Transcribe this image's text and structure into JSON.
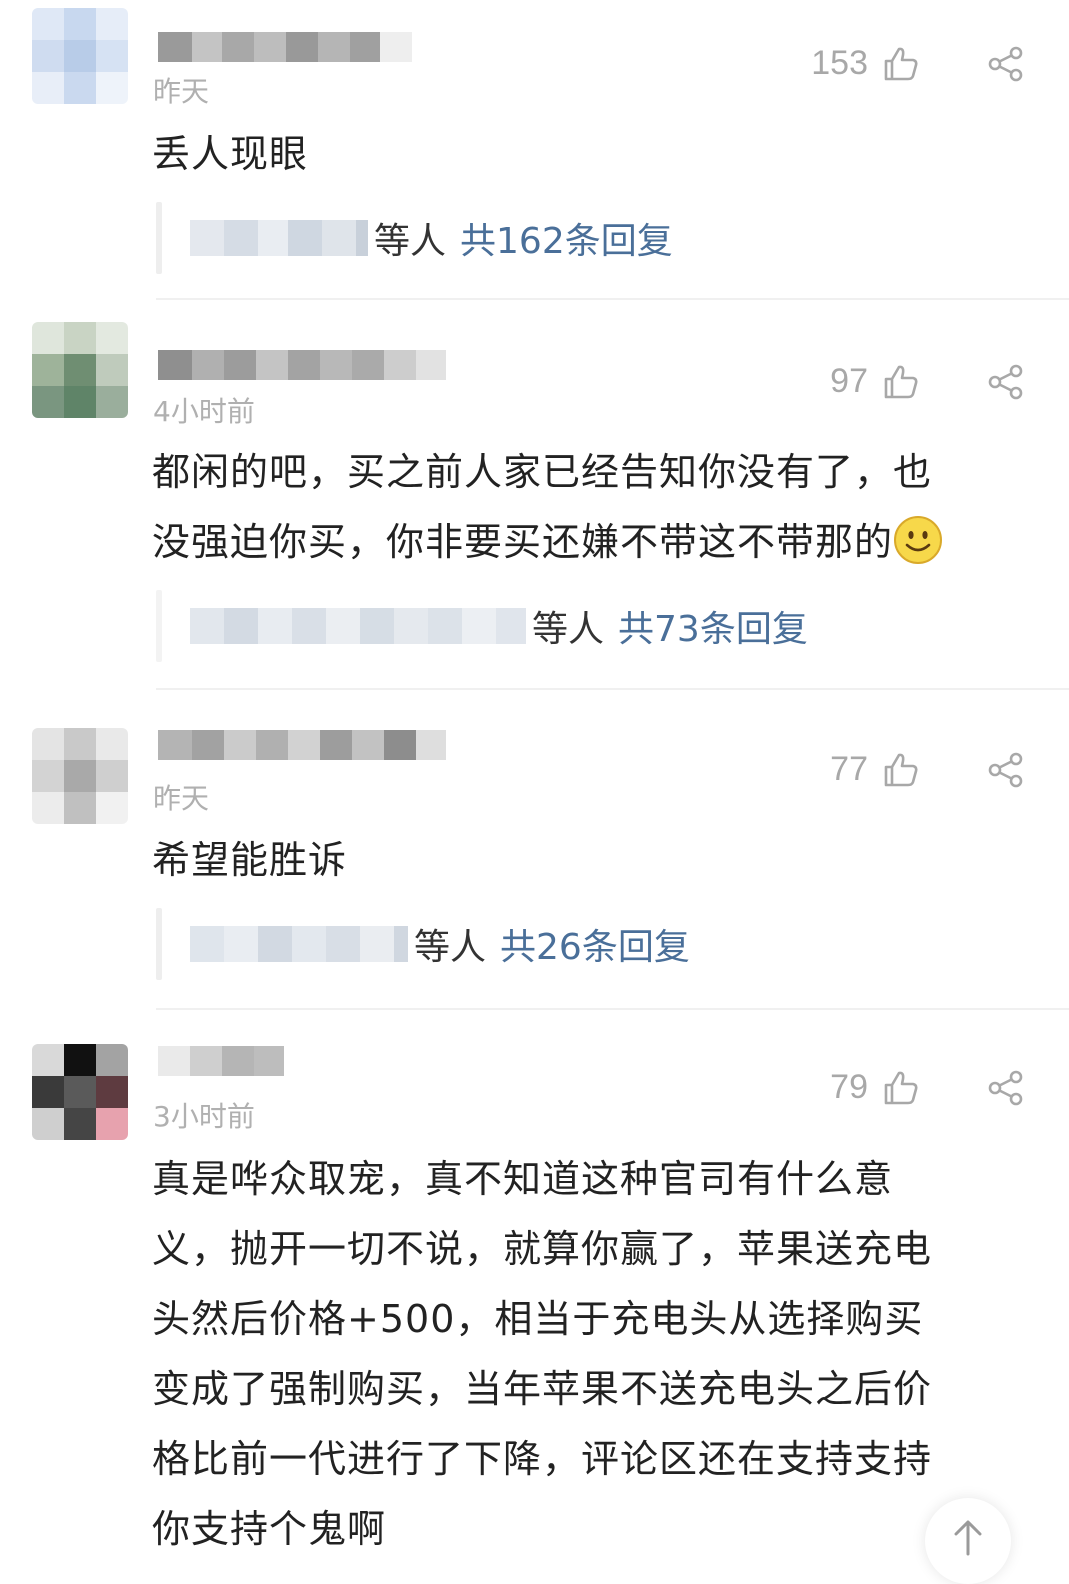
{
  "comments": [
    {
      "time": "昨天",
      "likes": "153",
      "text": [
        "丢人现眼"
      ],
      "reply_suffix": "等人",
      "reply_count": "共162条回复"
    },
    {
      "time": "4小时前",
      "likes": "97",
      "text": [
        "都闲的吧，买之前人家已经告知你没有了，也",
        "没强迫你买，你非要买还嫌不带这不带那的"
      ],
      "emoji": "smile-emoji",
      "reply_suffix": "等人",
      "reply_count": "共73条回复"
    },
    {
      "time": "昨天",
      "likes": "77",
      "text": [
        "希望能胜诉"
      ],
      "reply_suffix": "等人",
      "reply_count": "共26条回复"
    },
    {
      "time": "3小时前",
      "likes": "79",
      "text": [
        "真是哗众取宠，真不知道这种官司有什么意",
        "义，抛开一切不说，就算你赢了，苹果送充电",
        "头然后价格+500，相当于充电头从选择购买",
        "变成了强制购买，当年苹果不送充电头之后价",
        "格比前一代进行了下降，评论区还在支持支持",
        "你支持个鬼啊"
      ]
    }
  ],
  "icons": {
    "like": "thumbs-up-icon",
    "share": "share-icon",
    "scroll_top": "arrow-up-icon"
  },
  "colors": {
    "reply_link": "#4a6f99",
    "muted": "#b0b0b0"
  }
}
